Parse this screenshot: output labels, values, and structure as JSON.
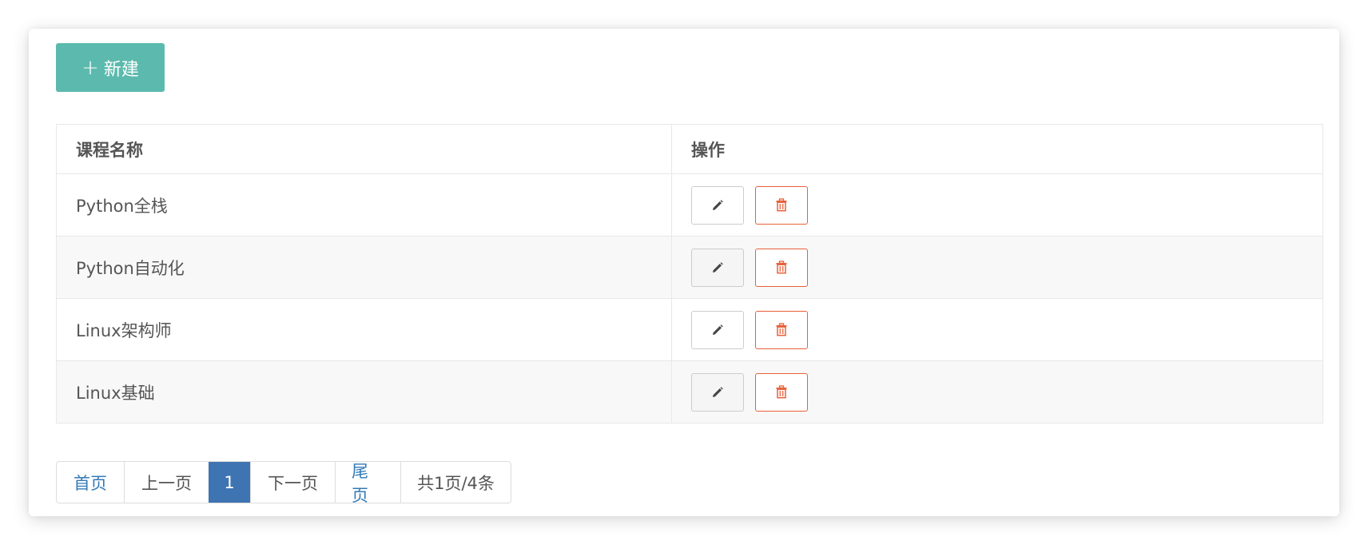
{
  "toolbar": {
    "new_label": "新建",
    "new_icon": "plus-icon"
  },
  "table": {
    "headers": [
      "课程名称",
      "操作"
    ],
    "rows": [
      {
        "name": "Python全栈"
      },
      {
        "name": "Python自动化"
      },
      {
        "name": "Linux架构师"
      },
      {
        "name": "Linux基础"
      }
    ],
    "edit_icon": "pencil-icon",
    "delete_icon": "trash-icon"
  },
  "pagination": {
    "first": "首页",
    "prev": "上一页",
    "current": "1",
    "next": "下一页",
    "last": "尾页",
    "summary": "共1页/4条"
  },
  "colors": {
    "primary_button": "#5bbaad",
    "delete_accent": "#e8603a",
    "active_page": "#3f74b2",
    "link": "#337ab7"
  }
}
